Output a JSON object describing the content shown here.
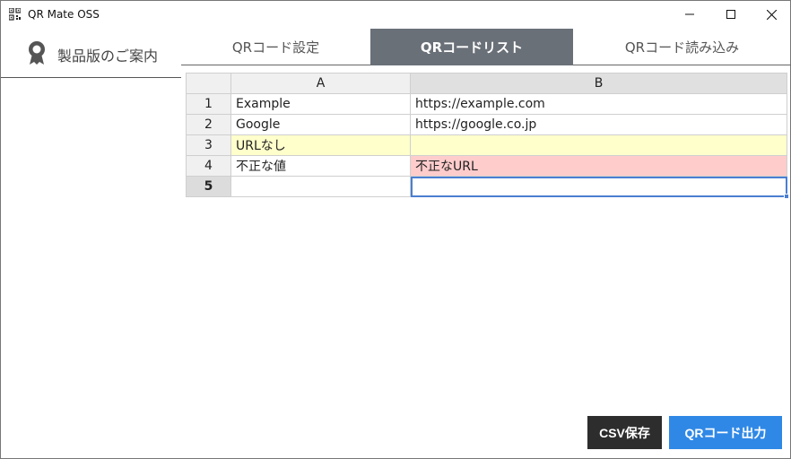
{
  "window": {
    "title": "QR Mate OSS"
  },
  "sidebar": {
    "product_link": "製品版のご案内"
  },
  "tabs": [
    {
      "label": "QRコード設定"
    },
    {
      "label": "QRコードリスト"
    },
    {
      "label": "QRコード読み込み"
    }
  ],
  "grid": {
    "columns": [
      "A",
      "B"
    ],
    "rows": [
      {
        "num": "1",
        "a": "Example",
        "b": "https://example.com"
      },
      {
        "num": "2",
        "a": "Google",
        "b": "https://google.co.jp"
      },
      {
        "num": "3",
        "a": "URLなし",
        "b": ""
      },
      {
        "num": "4",
        "a": "不正な値",
        "b": "不正なURL"
      },
      {
        "num": "5",
        "a": "",
        "b": ""
      }
    ]
  },
  "buttons": {
    "csv_save": "CSV保存",
    "qr_output": "QRコード出力"
  },
  "colors": {
    "active_tab": "#6a7078",
    "primary_button": "#2f88e6",
    "dark_button": "#2d2d2d",
    "warning_row": "#ffffcc",
    "error_cell": "#ffcccc",
    "selection": "#4a7fd1"
  },
  "icons": {
    "app": "qr-code-icon",
    "sidebar": "award-ribbon-icon"
  }
}
